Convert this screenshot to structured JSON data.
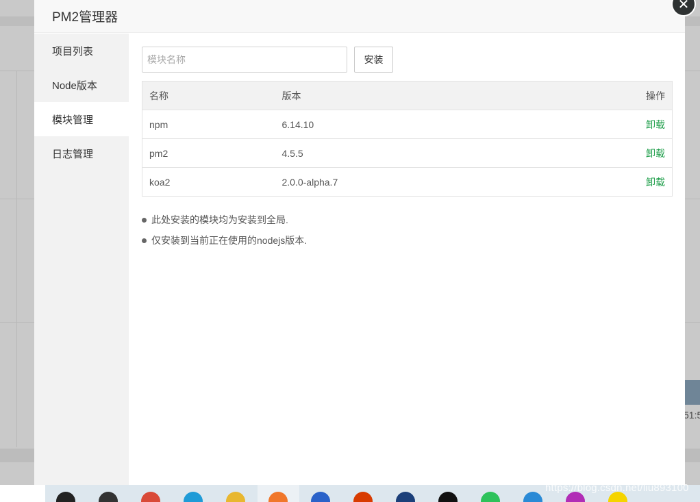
{
  "dialog": {
    "title": "PM2管理器",
    "close_glyph": "✕"
  },
  "sidebar": {
    "items": [
      {
        "label": "项目列表",
        "active": false
      },
      {
        "label": "Node版本",
        "active": false
      },
      {
        "label": "模块管理",
        "active": true
      },
      {
        "label": "日志管理",
        "active": false
      }
    ]
  },
  "search": {
    "placeholder": "模块名称",
    "value": "",
    "install_label": "安装"
  },
  "table": {
    "headers": {
      "name": "名称",
      "version": "版本",
      "action": "操作"
    },
    "rows": [
      {
        "name": "npm",
        "version": "6.14.10",
        "action": "卸载"
      },
      {
        "name": "pm2",
        "version": "4.5.5",
        "action": "卸载"
      },
      {
        "name": "koa2",
        "version": "2.0.0-alpha.7",
        "action": "卸载"
      }
    ]
  },
  "notes": [
    "此处安装的模块均为安装到全局.",
    "仅安装到当前正在使用的nodejs版本."
  ],
  "background": {
    "tick_text": "51:5"
  },
  "watermark": "https://blog.csdn.net/liu893100",
  "taskbar": {
    "icons": [
      {
        "name": "search-icon",
        "color": "#222222"
      },
      {
        "name": "task-view-icon",
        "color": "#333333"
      },
      {
        "name": "chrome-icon",
        "color": "#d94a38"
      },
      {
        "name": "edge-icon",
        "color": "#1f9bd7"
      },
      {
        "name": "file-explorer-icon",
        "color": "#e8b730"
      },
      {
        "name": "firefox-icon",
        "color": "#f0772b"
      },
      {
        "name": "app-blue-icon",
        "color": "#2a62c9"
      },
      {
        "name": "office-icon",
        "color": "#d83b01"
      },
      {
        "name": "photoshop-icon",
        "color": "#1b3f79"
      },
      {
        "name": "qq-icon",
        "color": "#111111"
      },
      {
        "name": "wechat-icon",
        "color": "#2ec25b"
      },
      {
        "name": "vscode-icon",
        "color": "#2a8ad6"
      },
      {
        "name": "phpstorm-icon",
        "color": "#b12db6"
      },
      {
        "name": "app-yellow-icon",
        "color": "#f5d400"
      }
    ]
  }
}
